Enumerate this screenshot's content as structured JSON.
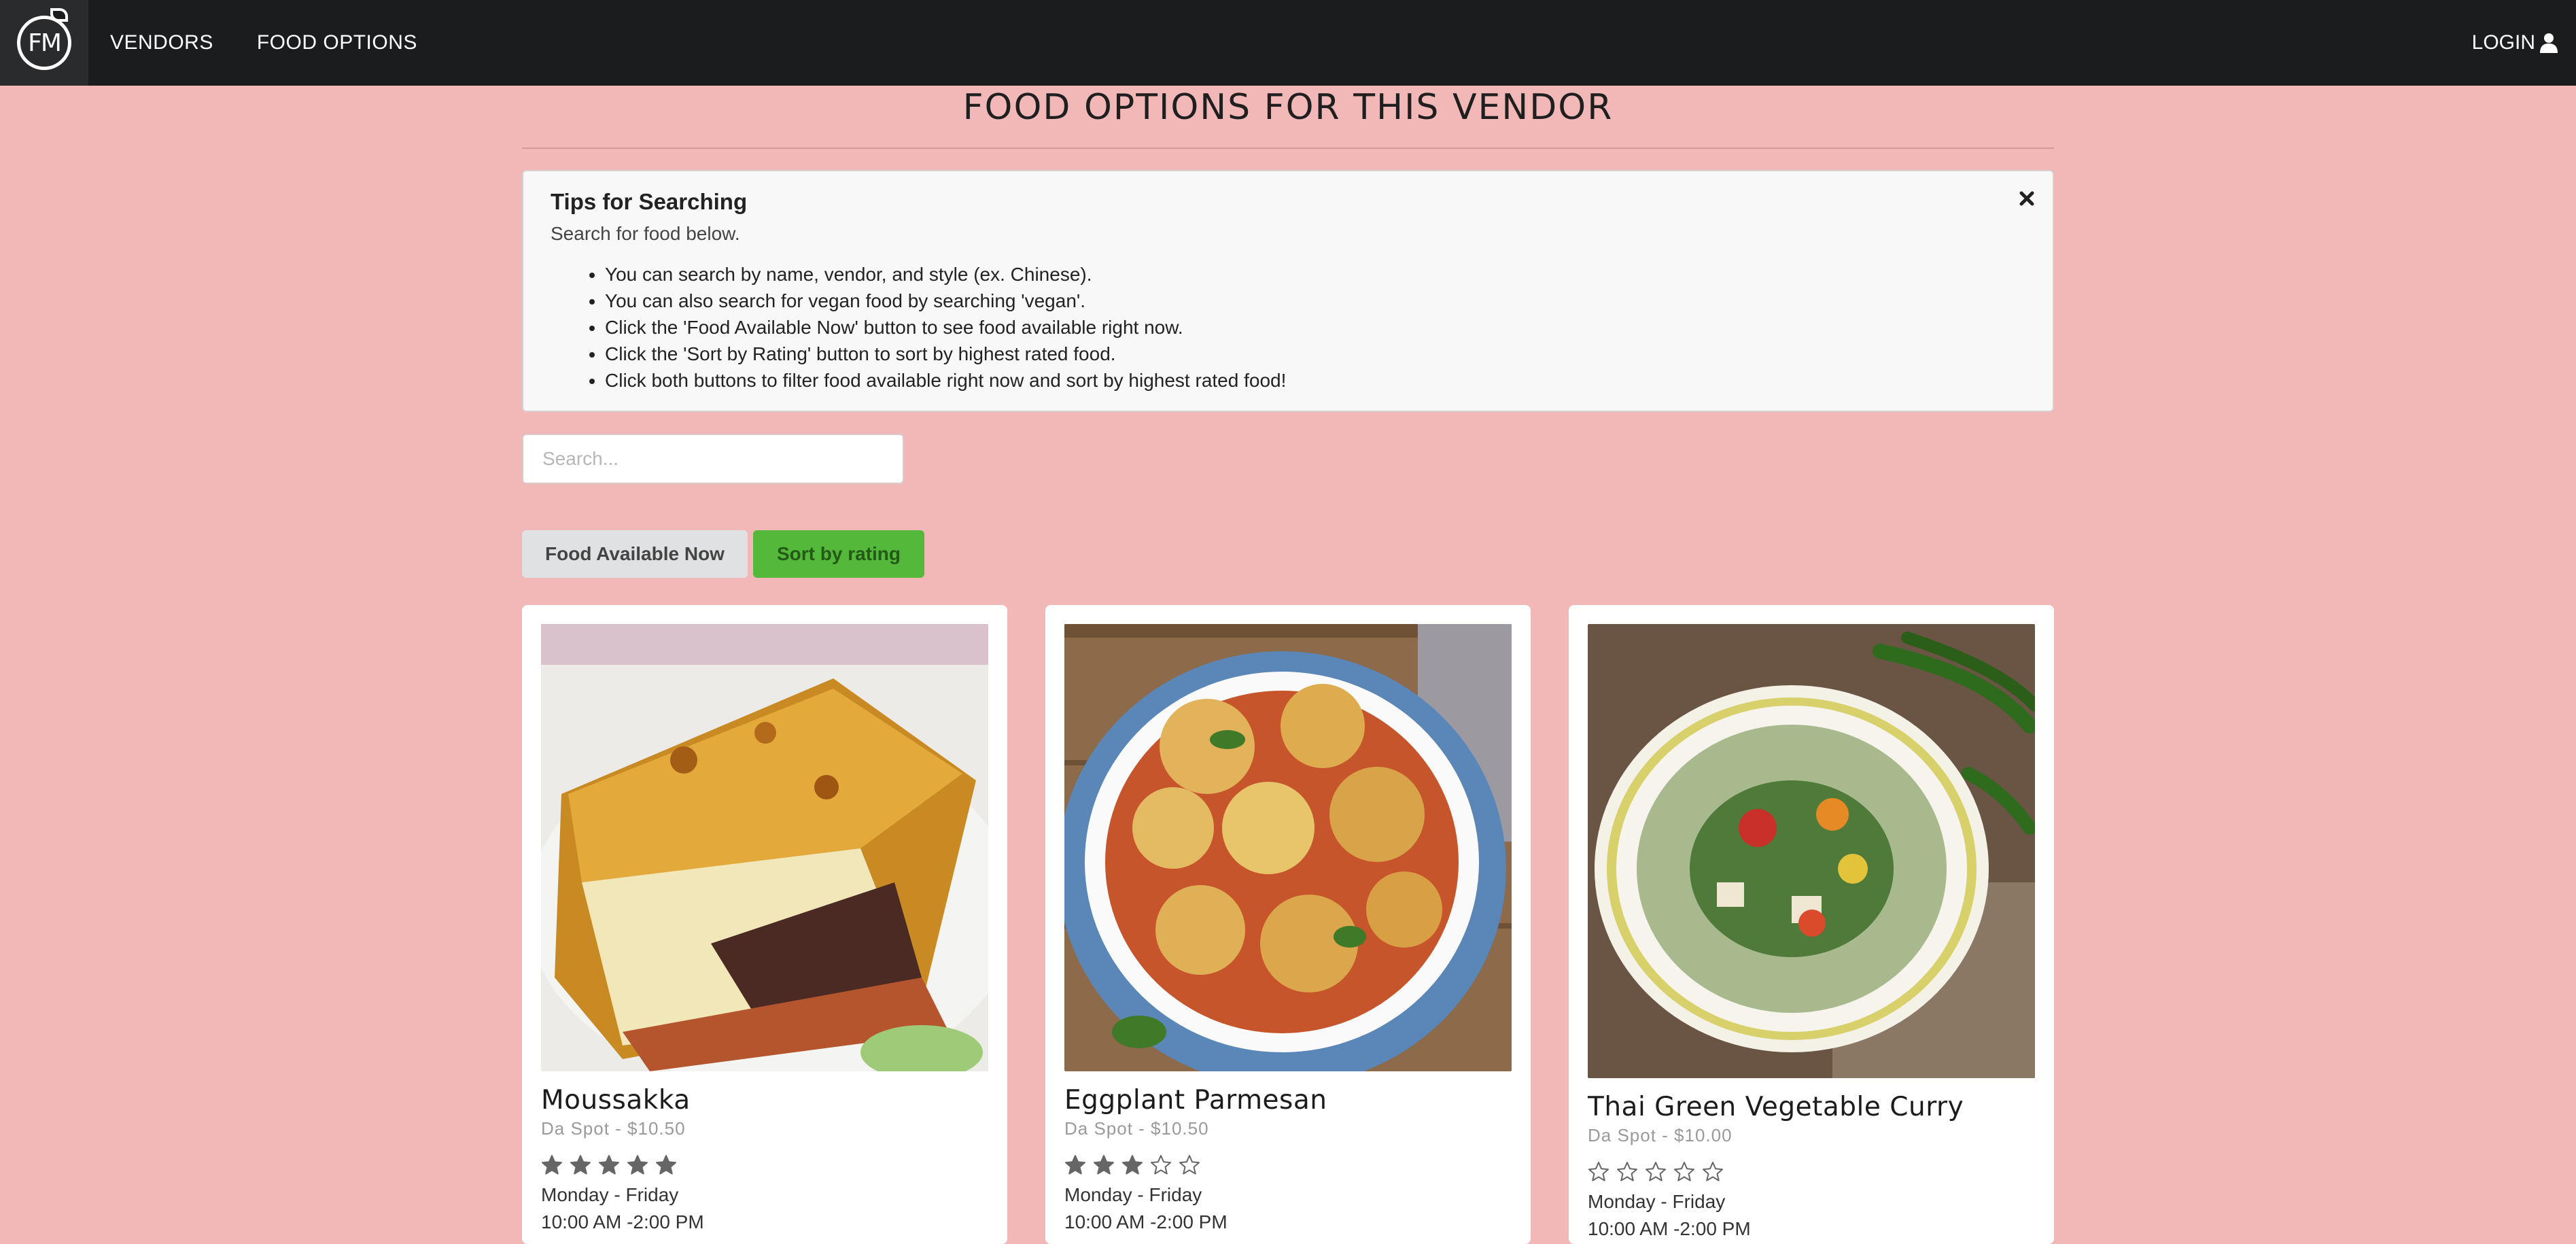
{
  "nav": {
    "logo_text": "FM",
    "items": [
      {
        "label": "VENDORS"
      },
      {
        "label": "FOOD OPTIONS"
      }
    ],
    "login_label": "LOGIN"
  },
  "page": {
    "title": "FOOD OPTIONS FOR THIS VENDOR"
  },
  "tips": {
    "title": "Tips for Searching",
    "subtitle": "Search for food below.",
    "items": [
      "You can search by name, vendor, and style (ex. Chinese).",
      "You can also search for vegan food by searching 'vegan'.",
      "Click the 'Food Available Now' button to see food available right now.",
      "Click the 'Sort by Rating' button to sort by highest rated food.",
      "Click both buttons to filter food available right now and sort by highest rated food!"
    ]
  },
  "search": {
    "placeholder": "Search..."
  },
  "buttons": {
    "available_label": "Food Available Now",
    "rating_label": "Sort by rating"
  },
  "cards": [
    {
      "name": "Moussakka",
      "meta": "Da Spot - $10.50",
      "rating": 5,
      "days": "Monday - Friday",
      "hours": "10:00 AM -2:00 PM",
      "image": "moussaka-photo"
    },
    {
      "name": "Eggplant Parmesan",
      "meta": "Da Spot - $10.50",
      "rating": 3,
      "days": "Monday - Friday",
      "hours": "10:00 AM -2:00 PM",
      "image": "eggplant-parmesan-photo"
    },
    {
      "name": "Thai Green Vegetable Curry",
      "meta": "Da Spot - $10.00",
      "rating": 0,
      "days": "Monday - Friday",
      "hours": "10:00 AM -2:00 PM",
      "image": "thai-green-curry-photo"
    }
  ],
  "colors": {
    "background": "#f2b8b7",
    "navbar": "#1b1c1d",
    "rating_button": "#54b83b",
    "star_filled": "#666666"
  }
}
